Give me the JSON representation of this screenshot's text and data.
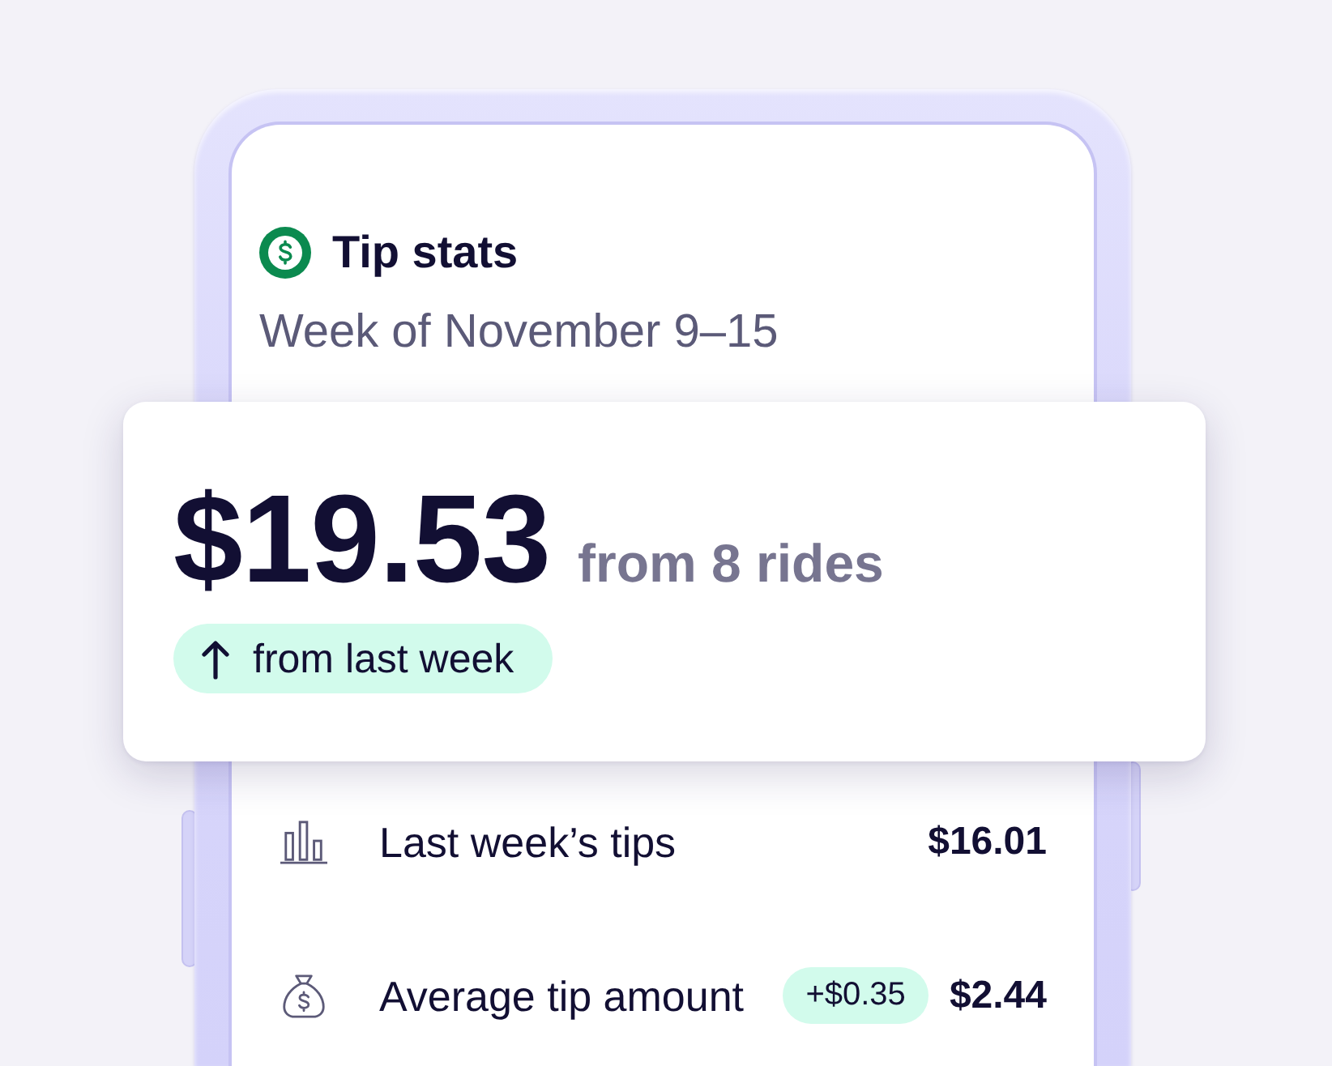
{
  "header": {
    "title": "Tip stats",
    "subtitle": "Week of November 9–15"
  },
  "summary": {
    "amount": "$19.53",
    "rides": "from 8 rides",
    "trend": {
      "rising": true,
      "label": "from last week"
    }
  },
  "stats": [
    {
      "kind": "chart",
      "label": "Last week’s tips",
      "value": "$16.01"
    },
    {
      "kind": "money_bag",
      "label": "Average tip amount",
      "change": "+$0.35",
      "value": "$2.44"
    }
  ]
}
